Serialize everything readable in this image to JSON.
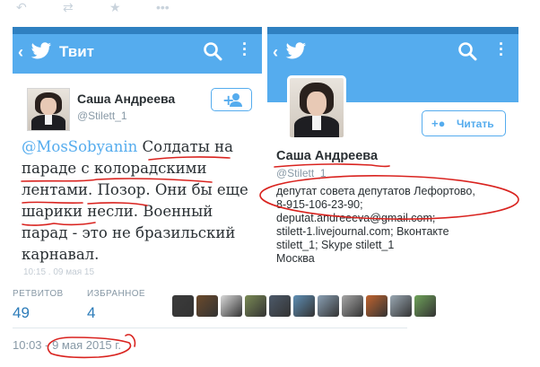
{
  "top_actions": {
    "reply_icon": "reply-icon",
    "retweet_icon": "retweet-icon",
    "favorite_icon": "star-icon",
    "more_icon": "more-icon"
  },
  "left_screen": {
    "header_title": "Твит",
    "back_icon": "back-icon",
    "bird_icon": "twitter-bird-icon",
    "search_icon": "search-icon",
    "more_icon": "overflow-icon",
    "author": {
      "name": "Саша Андреева",
      "handle": "@Stilett_1"
    },
    "tweet": {
      "mention": "@MosSobyanin",
      "text": "Солдаты на параде с колорадскими лентами. Позор. Они бы еще шарики несли. Военный парад - это не бразильский карнавал."
    },
    "faded_footer": "10:15 . 09 мая 15"
  },
  "right_screen": {
    "bird_icon": "twitter-bird-icon",
    "search_icon": "search-icon",
    "more_icon": "overflow-icon",
    "follow_label": "Читать",
    "profile": {
      "name": "Саша Андреева",
      "handle": "@Stilett_1"
    },
    "bio": [
      "депутат совета депутатов Лефортово,",
      "8-915-106-23-90;",
      "deputat.andreeeva@gmail.com;",
      "stilett-1.livejournal.com; Вконтакте",
      "stilett_1; Skype stilett_1",
      "Москва"
    ]
  },
  "stats": {
    "retweets_label": "РЕТВИТОВ",
    "retweets_value": "49",
    "favorites_label": "ИЗБРАННОЕ",
    "favorites_value": "4"
  },
  "favoriters_colors": [
    "#3b3b3b",
    "#6b4a2b",
    "#d9d9d9",
    "#7a8a55",
    "#4d5a6a",
    "#5f8fb5",
    "#8aa0b4",
    "#a6a6a6",
    "#c1642f",
    "#9aa8b3",
    "#6fa35a"
  ],
  "timestamp": "10:03 - 9 мая 2015 г.",
  "colors": {
    "brand": "#55acee",
    "link": "#2b7bb9",
    "annotation": "#d9231f"
  }
}
